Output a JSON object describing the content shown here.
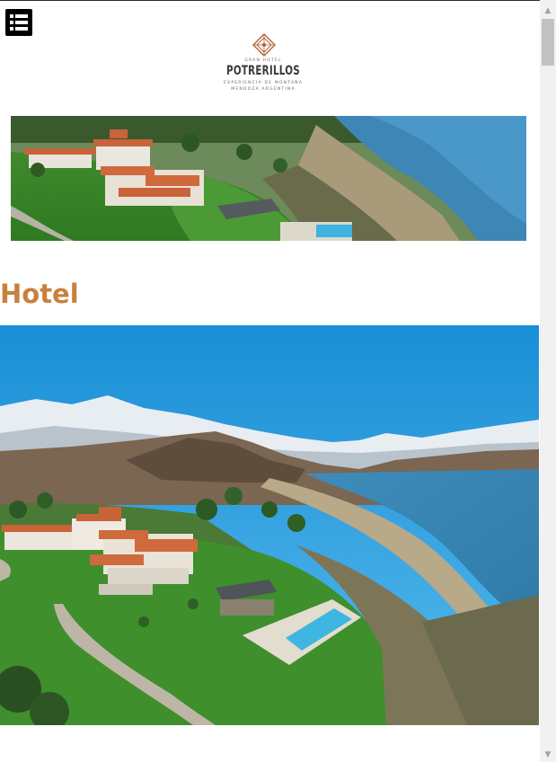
{
  "header": {
    "menu_icon": "list-menu-icon",
    "logo": {
      "top_text": "GRAN HOTEL",
      "name": "POTRERILLOS",
      "tagline": "EXPERIENCIA DE MONTAÑA",
      "location": "MENDOZA ARGENTINA"
    }
  },
  "main": {
    "heading": "Hotel"
  },
  "colors": {
    "heading": "#c8803f",
    "logo_accent": "#b5623c"
  },
  "scrollbar": {
    "up_icon": "scroll-up-arrow-icon",
    "down_icon": "scroll-down-arrow-icon"
  }
}
